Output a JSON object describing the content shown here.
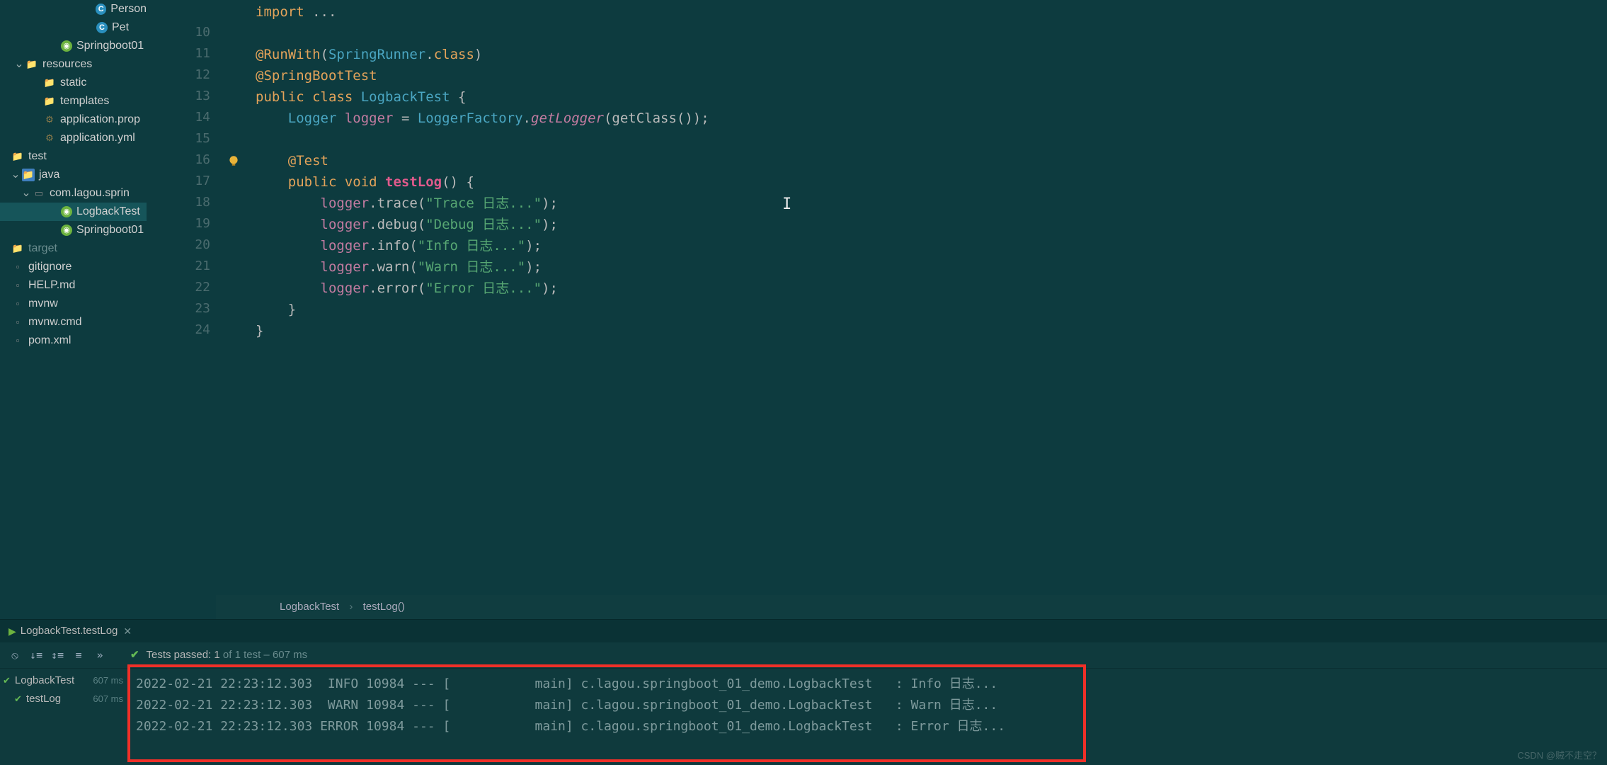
{
  "sidebar": {
    "items": [
      {
        "indent": 120,
        "icon": "cls",
        "label": "Person"
      },
      {
        "indent": 120,
        "icon": "cls",
        "label": "Pet"
      },
      {
        "indent": 70,
        "icon": "spr",
        "label": "Springboot01"
      },
      {
        "indent": 20,
        "chev": "v",
        "icon": "folder",
        "label": "resources"
      },
      {
        "indent": 45,
        "icon": "folder",
        "label": "static"
      },
      {
        "indent": 45,
        "icon": "folder",
        "label": "templates"
      },
      {
        "indent": 45,
        "icon": "cfg",
        "label": "application.prop"
      },
      {
        "indent": 45,
        "icon": "cfg",
        "label": "application.yml"
      },
      {
        "indent": 0,
        "icon": "folder",
        "label": "test"
      },
      {
        "indent": 15,
        "chev": "v",
        "icon": "folder",
        "label": "java",
        "folderColor": "#3f7fbf"
      },
      {
        "indent": 30,
        "chev": "v",
        "icon": "pkg",
        "label": "com.lagou.sprin"
      },
      {
        "indent": 70,
        "icon": "spr",
        "label": "LogbackTest",
        "sel": true
      },
      {
        "indent": 70,
        "icon": "spr",
        "label": "Springboot01"
      },
      {
        "indent": 0,
        "icon": "folder",
        "label": "target",
        "dim": true
      },
      {
        "indent": 0,
        "icon": "file",
        "label": "gitignore"
      },
      {
        "indent": 0,
        "icon": "file",
        "label": "HELP.md"
      },
      {
        "indent": 0,
        "icon": "file",
        "label": "mvnw"
      },
      {
        "indent": 0,
        "icon": "file",
        "label": "mvnw.cmd"
      },
      {
        "indent": 0,
        "icon": "file",
        "label": "pom.xml"
      }
    ]
  },
  "gutter": {
    "lines": [
      "",
      "10",
      "11",
      "12",
      "13",
      "14",
      "15",
      "16",
      "17",
      "18",
      "19",
      "20",
      "21",
      "22",
      "23",
      "24"
    ],
    "markers": {
      "3": "spring",
      "4": "run",
      "8": "run",
      "7": "bulb"
    }
  },
  "code": {
    "lines": [
      [
        {
          "c": "c-kw",
          "t": "import"
        },
        {
          "c": "c-plain",
          "t": " ..."
        }
      ],
      [],
      [
        {
          "c": "c-ann",
          "t": "@RunWith"
        },
        {
          "c": "c-punct",
          "t": "("
        },
        {
          "c": "c-type",
          "t": "SpringRunner"
        },
        {
          "c": "c-punct",
          "t": "."
        },
        {
          "c": "c-kw",
          "t": "class"
        },
        {
          "c": "c-punct",
          "t": ")"
        }
      ],
      [
        {
          "c": "c-ann",
          "t": "@SpringBootTest"
        }
      ],
      [
        {
          "c": "c-kw",
          "t": "public class "
        },
        {
          "c": "c-type",
          "t": "LogbackTest"
        },
        {
          "c": "c-punct",
          "t": " {"
        }
      ],
      [
        {
          "c": "c-plain",
          "t": "    "
        },
        {
          "c": "c-type",
          "t": "Logger"
        },
        {
          "c": "c-plain",
          "t": " "
        },
        {
          "c": "c-field",
          "t": "logger"
        },
        {
          "c": "c-plain",
          "t": " = "
        },
        {
          "c": "c-type",
          "t": "LoggerFactory"
        },
        {
          "c": "c-punct",
          "t": "."
        },
        {
          "c": "c-call",
          "t": "getLogger"
        },
        {
          "c": "c-punct",
          "t": "(getClass());"
        }
      ],
      [],
      [
        {
          "c": "c-plain",
          "t": "    "
        },
        {
          "c": "c-ann",
          "t": "@Test"
        }
      ],
      [
        {
          "c": "c-plain",
          "t": "    "
        },
        {
          "c": "c-kw",
          "t": "public void "
        },
        {
          "c": "c-method",
          "t": "testLog"
        },
        {
          "c": "c-punct",
          "t": "() {"
        }
      ],
      [
        {
          "c": "c-plain",
          "t": "        "
        },
        {
          "c": "c-field",
          "t": "logger"
        },
        {
          "c": "c-punct",
          "t": ".trace("
        },
        {
          "c": "c-str",
          "t": "\"Trace 日志...\""
        },
        {
          "c": "c-punct",
          "t": ");"
        }
      ],
      [
        {
          "c": "c-plain",
          "t": "        "
        },
        {
          "c": "c-field",
          "t": "logger"
        },
        {
          "c": "c-punct",
          "t": ".debug("
        },
        {
          "c": "c-str",
          "t": "\"Debug 日志...\""
        },
        {
          "c": "c-punct",
          "t": ");"
        }
      ],
      [
        {
          "c": "c-plain",
          "t": "        "
        },
        {
          "c": "c-field",
          "t": "logger"
        },
        {
          "c": "c-punct",
          "t": ".info("
        },
        {
          "c": "c-str",
          "t": "\"Info 日志...\""
        },
        {
          "c": "c-punct",
          "t": ");"
        }
      ],
      [
        {
          "c": "c-plain",
          "t": "        "
        },
        {
          "c": "c-field",
          "t": "logger"
        },
        {
          "c": "c-punct",
          "t": ".warn("
        },
        {
          "c": "c-str",
          "t": "\"Warn 日志...\""
        },
        {
          "c": "c-punct",
          "t": ");"
        }
      ],
      [
        {
          "c": "c-plain",
          "t": "        "
        },
        {
          "c": "c-field",
          "t": "logger"
        },
        {
          "c": "c-punct",
          "t": ".error("
        },
        {
          "c": "c-str",
          "t": "\"Error 日志...\""
        },
        {
          "c": "c-punct",
          "t": ");"
        }
      ],
      [
        {
          "c": "c-punct",
          "t": "    }"
        }
      ],
      [
        {
          "c": "c-punct",
          "t": "}"
        }
      ]
    ]
  },
  "breadcrumb": {
    "a": "LogbackTest",
    "b": "testLog()"
  },
  "run": {
    "tab": "LogbackTest.testLog",
    "status_prefix": "Tests passed: ",
    "status_num": "1",
    "status_of": " of 1 test",
    "status_time": " – 607 ms",
    "tree": [
      {
        "label": "LogbackTest",
        "time": "607 ms"
      },
      {
        "label": "testLog",
        "time": "607 ms"
      }
    ],
    "log": [
      "2022-02-21 22:23:12.303  INFO 10984 --- [           main] c.lagou.springboot_01_demo.LogbackTest   : Info 日志...",
      "2022-02-21 22:23:12.303  WARN 10984 --- [           main] c.lagou.springboot_01_demo.LogbackTest   : Warn 日志...",
      "2022-02-21 22:23:12.303 ERROR 10984 --- [           main] c.lagou.springboot_01_demo.LogbackTest   : Error 日志..."
    ]
  },
  "watermark": "CSDN @贼不走空？"
}
